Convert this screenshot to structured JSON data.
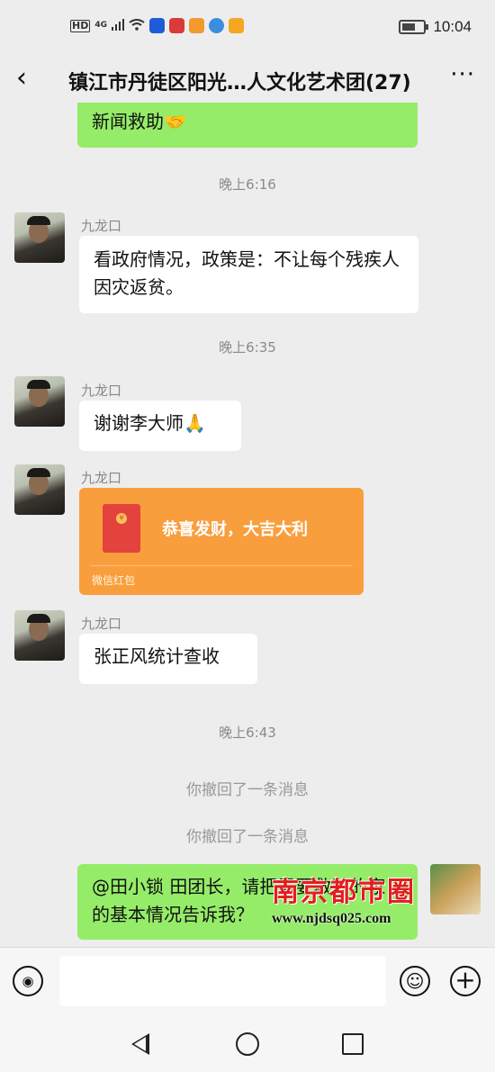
{
  "status_bar": {
    "hd": "HD",
    "signal": "4G",
    "time": "10:04",
    "app_icons": [
      {
        "name": "baidu-app-icon",
        "color": "#1e5bd8"
      },
      {
        "name": "news-app-icon",
        "color": "#d93a3a"
      },
      {
        "name": "video-app-icon",
        "color": "#f29a2e"
      },
      {
        "name": "browser-app-icon",
        "color": "#3b8de0"
      },
      {
        "name": "wallet-app-icon",
        "color": "#f5a623"
      }
    ]
  },
  "header": {
    "back_icon": "‹",
    "title": "镇江市丹徒区阳光…人文化艺术团(27)",
    "more_icon": "···"
  },
  "chat": {
    "partial_message": "新闻救助🤝",
    "times": [
      "晚上6:16",
      "晚上6:35",
      "晚上6:43"
    ],
    "messages": [
      {
        "sender": "九龙口",
        "text": "看政府情况，政策是：不让每个残疾人因灾返贫。"
      },
      {
        "sender": "九龙口",
        "text": "谢谢李大师🙏"
      },
      {
        "sender": "九龙口",
        "red_packet": {
          "title": "恭喜发财，大吉大利",
          "label": "微信红包"
        }
      },
      {
        "sender": "九龙口",
        "text": "张正风统计查收"
      }
    ],
    "recalled": [
      "你撤回了一条消息",
      "你撤回了一条消息"
    ],
    "sent_message": "@田小锁  田团长，请把需要救助的家的基本情况告诉我？"
  },
  "watermark": {
    "title": "南京都市圈",
    "url": "www.njdsq025.com"
  },
  "input_bar": {
    "voice_icon": "◉",
    "emoji_icon": "☺",
    "plus_icon": "+"
  },
  "colors": {
    "background": "#ededed",
    "sent_bubble": "#95ec69",
    "red_packet": "#f99e3d"
  }
}
